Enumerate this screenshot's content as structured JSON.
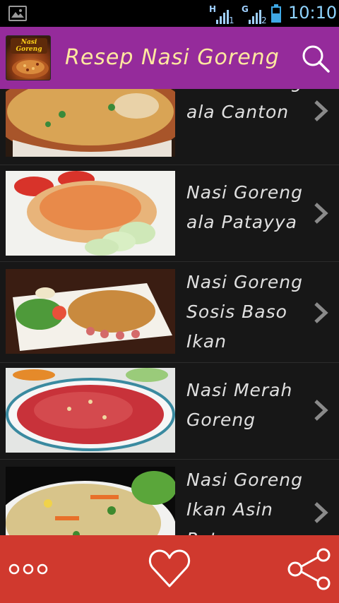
{
  "status_bar": {
    "signal_1": {
      "network": "H",
      "index": "1"
    },
    "signal_2": {
      "network": "G",
      "index": "2"
    },
    "time": "10:10"
  },
  "action_bar": {
    "app_icon_text": "Nasi Goreng",
    "title": "Resep Nasi Goreng",
    "search_icon": "search-icon"
  },
  "recipes": [
    {
      "title": "Nasi Goreng ala Canton"
    },
    {
      "title": "Nasi Goreng ala Patayya"
    },
    {
      "title": "Nasi Goreng Sosis Baso Ikan"
    },
    {
      "title": "Nasi Merah Goreng"
    },
    {
      "title": "Nasi Goreng Ikan Asin Pete"
    }
  ],
  "bottom_bar": {
    "more_icon": "more-dots-icon",
    "favorite_icon": "heart-icon",
    "share_icon": "share-icon"
  },
  "colors": {
    "action_bar": "#952b9b",
    "bottom_bar": "#d0392e",
    "title_text": "#ffe8a0",
    "list_bg": "#171717"
  }
}
